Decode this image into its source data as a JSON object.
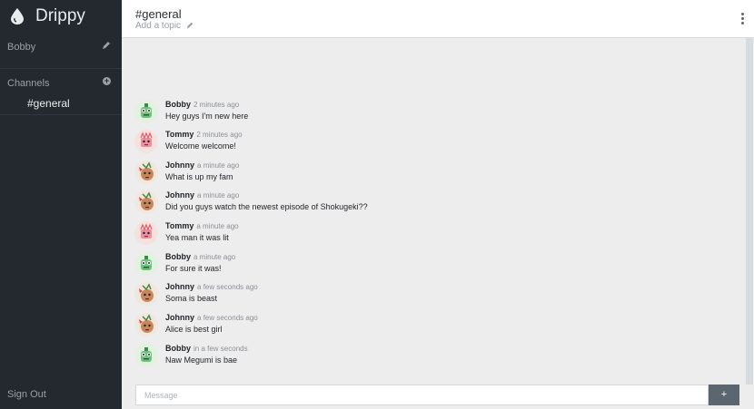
{
  "sidebar": {
    "app_name": "Drippy",
    "logo_icon": "water-drop-icon",
    "user": {
      "name": "Bobby",
      "edit_icon": "pencil-icon"
    },
    "channels": {
      "header": "Channels",
      "add_icon": "plus-circle-icon",
      "items": [
        {
          "label": "#general"
        }
      ]
    },
    "sign_out": "Sign Out"
  },
  "header": {
    "channel_name": "#general",
    "topic_placeholder": "Add a topic",
    "topic_edit_icon": "pencil-icon",
    "menu_icon": "kebab-menu-icon"
  },
  "messages": [
    {
      "author": "Bobby",
      "time": "2 minutes ago",
      "text": "Hey guys I'm new here",
      "avatar": "green-creature-avatar"
    },
    {
      "author": "Tommy",
      "time": "2 minutes ago",
      "text": "Welcome welcome!",
      "avatar": "pink-creature-avatar"
    },
    {
      "author": "Johnny",
      "time": "a minute ago",
      "text": "What is up my fam",
      "avatar": "brown-creature-avatar"
    },
    {
      "author": "Johnny",
      "time": "a minute ago",
      "text": "Did you guys watch the newest episode of Shokugeki??",
      "avatar": "brown-creature-avatar"
    },
    {
      "author": "Tommy",
      "time": "a minute ago",
      "text": "Yea man it was lit",
      "avatar": "pink-creature-avatar"
    },
    {
      "author": "Bobby",
      "time": "a minute ago",
      "text": "For sure it was!",
      "avatar": "green-creature-avatar"
    },
    {
      "author": "Johnny",
      "time": "a few seconds ago",
      "text": "Soma is beast",
      "avatar": "brown-creature-avatar"
    },
    {
      "author": "Johnny",
      "time": "a few seconds ago",
      "text": "Alice is best girl",
      "avatar": "brown-creature-avatar"
    },
    {
      "author": "Bobby",
      "time": "in a few seconds",
      "text": "Naw Megumi is bae",
      "avatar": "green-creature-avatar"
    }
  ],
  "composer": {
    "placeholder": "Message",
    "value": "",
    "send_label": "+"
  },
  "colors": {
    "sidebar_bg": "#24292f",
    "main_bg": "#ededed",
    "send_button": "#5b6670",
    "avatar_green_bg": "#e3f1e0",
    "avatar_pink_bg": "#f7e1dc",
    "avatar_brown_bg": "#f3e6dc"
  }
}
